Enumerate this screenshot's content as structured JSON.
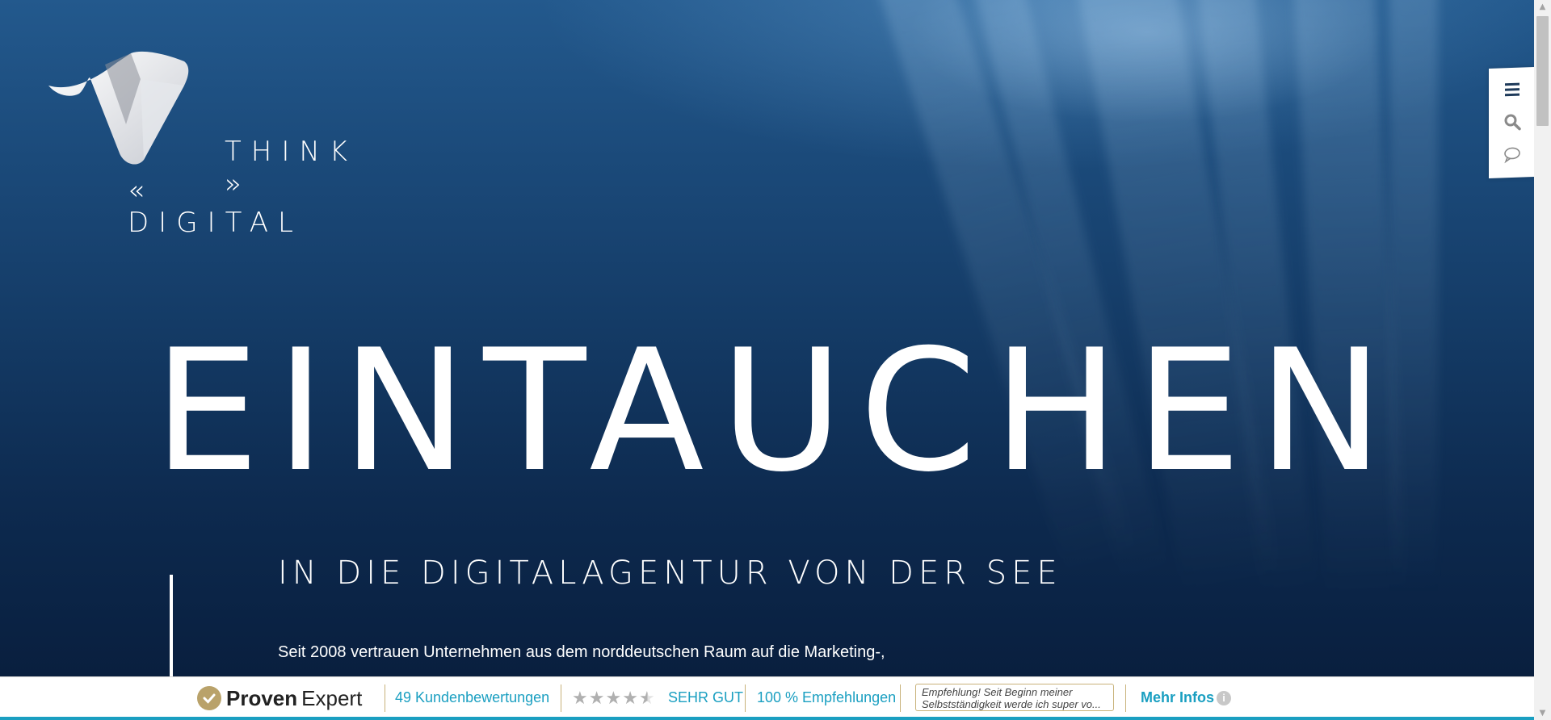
{
  "colors": {
    "accent": "#1a9fc1",
    "gold": "#b9a26a",
    "ocean_top": "#23598d",
    "ocean_bottom": "#081c3a"
  },
  "logo": {
    "think": "THINK »",
    "digital": "« DIGITAL",
    "mark_icon": "v-ribbon-logo-icon"
  },
  "side_tools": {
    "menu_icon": "hamburger-menu-icon",
    "search_icon": "search-icon",
    "chat_icon": "chat-bubble-icon"
  },
  "hero": {
    "headline": "EINTAUCHEN",
    "subheadline": "IN DIE DIGITALAGENTUR VON DER SEE",
    "intro": "Seit 2008 vertrauen Unternehmen aus dem norddeutschen Raum auf die Marketing-,"
  },
  "proven_expert": {
    "brand_bold": "Proven",
    "brand_light": "Expert",
    "reviews": "49 Kundenbewertungen",
    "stars": "★★★★★",
    "rating_fraction": 0.9,
    "rating_text": "SEHR GUT",
    "recommend": "100 % Empfehlungen",
    "quote_line1": "Empfehlung! Seit Beginn meiner",
    "quote_line2": "Selbstständigkeit werde ich super vo...",
    "more_info": "Mehr Infos",
    "info_icon": "info-icon"
  }
}
